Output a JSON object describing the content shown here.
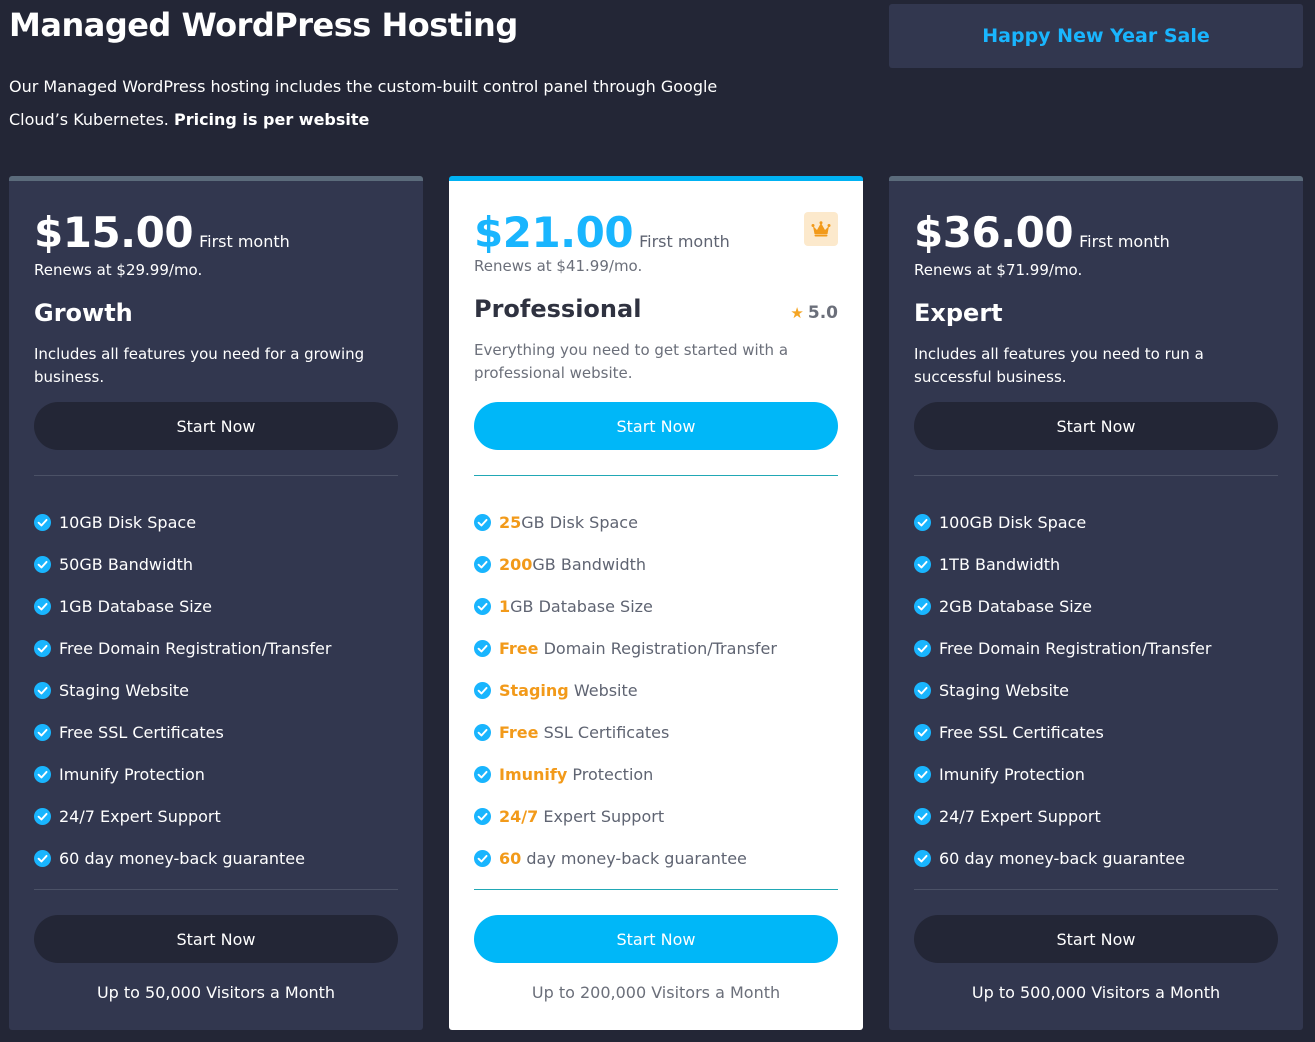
{
  "header": {
    "title": "Managed WordPress Hosting",
    "intro_text": "Our Managed WordPress hosting includes the custom-built control panel through Google Cloud’s Kubernetes.",
    "intro_bold": "Pricing is per website",
    "sale_label": "Happy New Year Sale"
  },
  "plans": [
    {
      "price": "$15.00",
      "price_note": "First month",
      "renews": "Renews at $29.99/mo.",
      "name": "Growth",
      "description": "Includes all features you need for a growing business.",
      "cta": "Start Now",
      "features": [
        {
          "hl": "",
          "text": "10GB Disk Space"
        },
        {
          "hl": "",
          "text": "50GB Bandwidth"
        },
        {
          "hl": "",
          "text": "1GB Database Size"
        },
        {
          "hl": "",
          "text": "Free Domain Registration/Transfer"
        },
        {
          "hl": "",
          "text": "Staging Website"
        },
        {
          "hl": "",
          "text": "Free SSL Certificates"
        },
        {
          "hl": "",
          "text": "Imunify Protection"
        },
        {
          "hl": "",
          "text": "24/7 Expert Support"
        },
        {
          "hl": "",
          "text": "60 day money-back guarantee"
        }
      ],
      "visitors": "Up to 50,000 Visitors a Month"
    },
    {
      "price": "$21.00",
      "price_note": "First month",
      "renews": "Renews at $41.99/mo.",
      "name": "Professional",
      "rating": "5.0",
      "badge_icon": "crown-icon",
      "description": "Everything you need to get started with a professional website.",
      "cta": "Start Now",
      "features": [
        {
          "hl": "25",
          "text": "GB Disk Space"
        },
        {
          "hl": "200",
          "text": "GB Bandwidth"
        },
        {
          "hl": "1",
          "text": "GB Database Size"
        },
        {
          "hl": "Free",
          "text": " Domain Registration/Transfer"
        },
        {
          "hl": "Staging",
          "text": " Website"
        },
        {
          "hl": "Free",
          "text": " SSL Certificates"
        },
        {
          "hl": "Imunify",
          "text": " Protection"
        },
        {
          "hl": "24/7",
          "text": " Expert Support"
        },
        {
          "hl": "60",
          "text": " day money-back guarantee"
        }
      ],
      "visitors": "Up to 200,000 Visitors a Month"
    },
    {
      "price": "$36.00",
      "price_note": "First month",
      "renews": "Renews at $71.99/mo.",
      "name": "Expert",
      "description": "Includes all features you need to run a successful business.",
      "cta": "Start Now",
      "features": [
        {
          "hl": "",
          "text": "100GB Disk Space"
        },
        {
          "hl": "",
          "text": "1TB Bandwidth"
        },
        {
          "hl": "",
          "text": "2GB Database Size"
        },
        {
          "hl": "",
          "text": "Free Domain Registration/Transfer"
        },
        {
          "hl": "",
          "text": "Staging Website"
        },
        {
          "hl": "",
          "text": "Free SSL Certificates"
        },
        {
          "hl": "",
          "text": "Imunify Protection"
        },
        {
          "hl": "",
          "text": "24/7 Expert Support"
        },
        {
          "hl": "",
          "text": "60 day money-back guarantee"
        }
      ],
      "visitors": "Up to 500,000 Visitors a Month"
    }
  ],
  "colors": {
    "background": "#232636",
    "card": "#32374f",
    "accent": "#19b5fe",
    "highlight": "#f29a1a"
  }
}
